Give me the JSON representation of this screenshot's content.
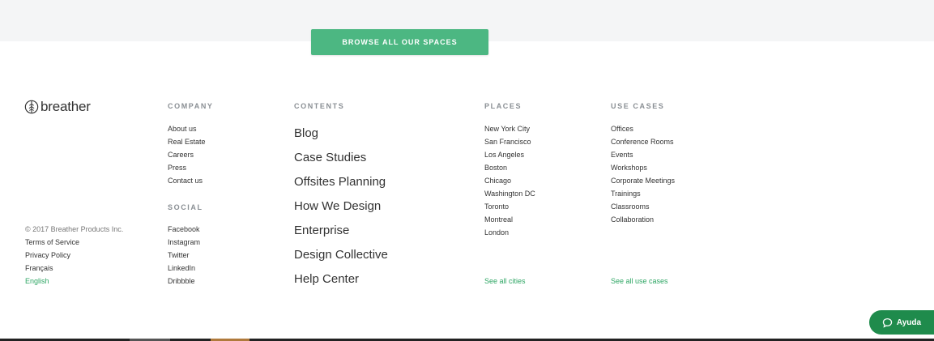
{
  "browse_button": "BROWSE ALL OUR SPACES",
  "brand": {
    "name": "breather"
  },
  "legal": {
    "copyright": "© 2017 Breather Products Inc.",
    "terms": "Terms of Service",
    "privacy": "Privacy Policy",
    "lang_fr": "Français",
    "lang_en": "English"
  },
  "company": {
    "title": "COMPANY",
    "links": [
      "About us",
      "Real Estate",
      "Careers",
      "Press",
      "Contact us"
    ]
  },
  "social": {
    "title": "SOCIAL",
    "links": [
      "Facebook",
      "Instagram",
      "Twitter",
      "LinkedIn",
      "Dribbble"
    ]
  },
  "contents": {
    "title": "CONTENTS",
    "links": [
      "Blog",
      "Case Studies",
      "Offsites Planning",
      "How We Design",
      "Enterprise",
      "Design Collective",
      "Help Center"
    ]
  },
  "places": {
    "title": "PLACES",
    "links": [
      "New York City",
      "San Francisco",
      "Los Angeles",
      "Boston",
      "Chicago",
      "Washington DC",
      "Toronto",
      "Montreal",
      "London"
    ],
    "see_all": "See all cities"
  },
  "use_cases": {
    "title": "USE CASES",
    "links": [
      "Offices",
      "Conference Rooms",
      "Events",
      "Workshops",
      "Corporate Meetings",
      "Trainings",
      "Classrooms",
      "Collaboration"
    ],
    "see_all": "See all use cases"
  },
  "help_button": "Ayuda",
  "colors": {
    "accent": "#4cb782",
    "link_green": "#2ea664",
    "help_bg": "#1f8b4c",
    "heading": "#8a8f94"
  },
  "icons": {
    "logo": "breather-leaf-icon",
    "help": "chat-bubble-icon"
  }
}
